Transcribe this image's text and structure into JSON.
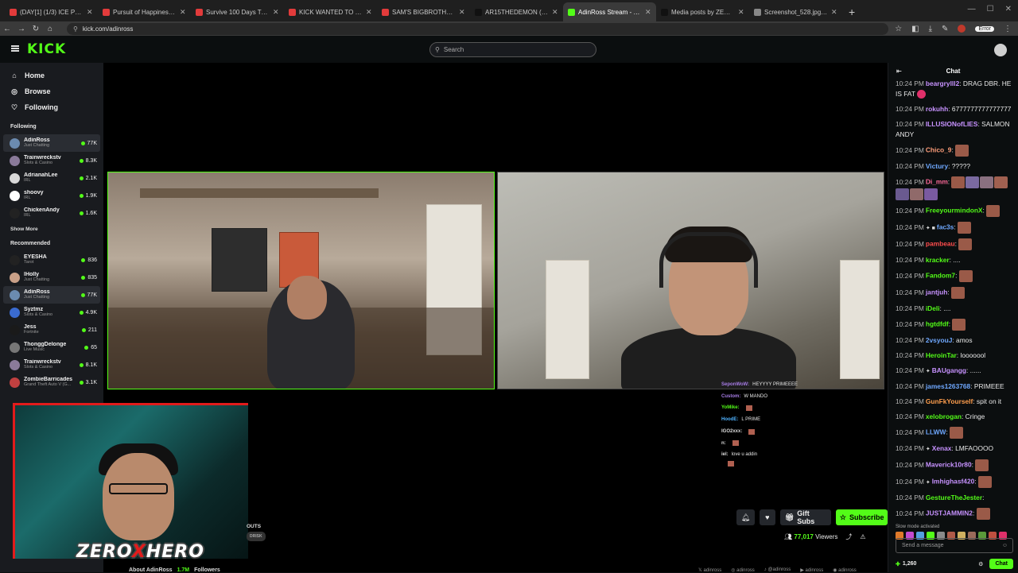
{
  "browser": {
    "tabs": [
      {
        "label": "(DAY[1] (1/3) ICE POSEIDON'S",
        "fav": "#e23b3b",
        "active": false
      },
      {
        "label": "Pursuit of Happiness [Steve Ad",
        "fav": "#e23b3b",
        "active": false
      },
      {
        "label": "Survive 100 Days Trapped In A",
        "fav": "#e23b3b",
        "active": false
      },
      {
        "label": "KICK WANTED TO SIGN ADIN",
        "fav": "#e23b3b",
        "active": false
      },
      {
        "label": "SAM'S BIGBROTHER HOUSE &",
        "fav": "#e23b3b",
        "active": false
      },
      {
        "label": "AR15THEDEMON (@AR15thed",
        "fav": "#111111",
        "active": false
      },
      {
        "label": "AdinRoss Stream - Watch Li",
        "fav": "#53fc18",
        "active": true
      },
      {
        "label": "Media posts by ZEROXHERO (",
        "fav": "#111111",
        "active": false
      },
      {
        "label": "Screenshot_528.jpg (1175×707)",
        "fav": "#888888",
        "active": false
      }
    ],
    "url": "kick.com/adinross",
    "error_label": "Error"
  },
  "header": {
    "logo": "KICK",
    "search_placeholder": "Search"
  },
  "sidebar": {
    "nav": [
      {
        "label": "Home",
        "icon": "home-icon"
      },
      {
        "label": "Browse",
        "icon": "compass-icon"
      },
      {
        "label": "Following",
        "icon": "heart-icon"
      }
    ],
    "following_title": "Following",
    "following": [
      {
        "name": "AdinRoss",
        "category": "Just Chatting",
        "viewers": "77K",
        "color": "#6b8bb0",
        "selected": true
      },
      {
        "name": "Trainwreckstv",
        "category": "Slots & Casino",
        "viewers": "8.3K",
        "color": "#8a7a9a",
        "selected": false
      },
      {
        "name": "AdrianahLee",
        "category": "IRL",
        "viewers": "2.1K",
        "color": "#d8d8d8",
        "selected": false
      },
      {
        "name": "shoovy",
        "category": "IRL",
        "viewers": "1.9K",
        "color": "#ffffff",
        "selected": false
      },
      {
        "name": "ChickenAndy",
        "category": "IRL",
        "viewers": "1.6K",
        "color": "#222222",
        "selected": false
      }
    ],
    "show_more": "Show More",
    "recommended_title": "Recommended",
    "recommended": [
      {
        "name": "EYESHA",
        "category": "Tarot",
        "viewers": "836",
        "color": "#222222",
        "selected": false
      },
      {
        "name": "lHolly",
        "category": "Just Chatting",
        "viewers": "835",
        "color": "#c9a088",
        "selected": false
      },
      {
        "name": "AdinRoss",
        "category": "Just Chatting",
        "viewers": "77K",
        "color": "#6b8bb0",
        "selected": true
      },
      {
        "name": "Syztmz",
        "category": "Slots & Casino",
        "viewers": "4.9K",
        "color": "#3a6bd0",
        "selected": false
      },
      {
        "name": "Jess",
        "category": "Fortnite",
        "viewers": "211",
        "color": "#1a1a1a",
        "selected": false
      },
      {
        "name": "ThonggDelonge",
        "category": "Live Music",
        "viewers": "65",
        "color": "#777777",
        "selected": false
      },
      {
        "name": "Trainwreckstv",
        "category": "Slots & Casino",
        "viewers": "8.1K",
        "color": "#8a7a9a",
        "selected": false
      },
      {
        "name": "ZombieBarricades",
        "category": "Grand Theft Auto V (G...",
        "viewers": "3.1K",
        "color": "#c04040",
        "selected": false
      }
    ]
  },
  "stream": {
    "overlay_chat": [
      {
        "user": "SeponWoW:",
        "text": "HEYYYY PRIMEEEE",
        "color": "#a77ce6"
      },
      {
        "user": "Custom:",
        "text": "W MANDO",
        "color": "#a77ce6"
      },
      {
        "user": "YoMike:",
        "text": "",
        "color": "#53fc18"
      },
      {
        "user": "HoodE:",
        "text": "L PRIME",
        "color": "#4fb3ff"
      },
      {
        "user": "IGO2xxx:",
        "text": "",
        "color": "#dddddd"
      },
      {
        "user": "n:",
        "text": "",
        "color": "#dddddd"
      },
      {
        "user": "iel:",
        "text": "love u addin",
        "color": "#dddddd"
      },
      {
        "user": "",
        "text": "",
        "color": "#e74c6b"
      }
    ],
    "logo_text_left": "ZERO",
    "logo_text_x": "X",
    "logo_text_right": "HERO",
    "info_partial": "OUTS",
    "info_tag": "DRISK",
    "about_label": "About AdinRoss",
    "about_follows": "1.7M",
    "about_follows_label": "Followers",
    "gift_label": "Gift Subs",
    "subscribe_label": "Subscribe",
    "viewers_count": "77,017",
    "viewers_label": "Viewers",
    "socials": [
      "adinross",
      "adinross",
      "@adinross",
      "adinross",
      "adinross"
    ]
  },
  "chat": {
    "title": "Chat",
    "messages": [
      {
        "ts": "10:24 PM",
        "user": "beargrylll2",
        "color": "#c792ff",
        "text": "DRAG DBR. HE IS FAT",
        "emotes": 1,
        "badge": ""
      },
      {
        "ts": "10:24 PM",
        "user": "rokuhh",
        "color": "#c792ff",
        "text": "6777777777777777",
        "emotes": 0,
        "badge": ""
      },
      {
        "ts": "10:24 PM",
        "user": "ILLUSIONofLIES",
        "color": "#c792ff",
        "text": "SALMON ANDY",
        "emotes": 0,
        "badge": ""
      },
      {
        "ts": "10:24 PM",
        "user": "Chico_9",
        "color": "#ff9e7a",
        "text": "",
        "emotes": 1,
        "badge": ""
      },
      {
        "ts": "10:24 PM",
        "user": "Victury",
        "color": "#6fa8ff",
        "text": "?????",
        "emotes": 0,
        "badge": ""
      },
      {
        "ts": "10:24 PM",
        "user": "Di_mm",
        "color": "#ff6b9a",
        "text": "",
        "emotes": 7,
        "badge": ""
      },
      {
        "ts": "10:24 PM",
        "user": "FreeyourmindonX",
        "color": "#53fc18",
        "text": "",
        "emotes": 1,
        "badge": ""
      },
      {
        "ts": "10:24 PM",
        "user": "fac3s",
        "color": "#6fa8ff",
        "text": "",
        "emotes": 1,
        "badge": "✦ ■"
      },
      {
        "ts": "10:24 PM",
        "user": "pambeau",
        "color": "#ff4d4d",
        "text": "",
        "emotes": 1,
        "badge": ""
      },
      {
        "ts": "10:24 PM",
        "user": "kracker",
        "color": "#53fc18",
        "text": "....",
        "emotes": 0,
        "badge": ""
      },
      {
        "ts": "10:24 PM",
        "user": "Fandom7",
        "color": "#53fc18",
        "text": "",
        "emotes": 1,
        "badge": ""
      },
      {
        "ts": "10:24 PM",
        "user": "jantjuh",
        "color": "#c792ff",
        "text": "",
        "emotes": 1,
        "badge": ""
      },
      {
        "ts": "10:24 PM",
        "user": "iDeli",
        "color": "#53fc18",
        "text": "....",
        "emotes": 0,
        "badge": ""
      },
      {
        "ts": "10:24 PM",
        "user": "hgtdfdf",
        "color": "#53fc18",
        "text": "",
        "emotes": 1,
        "badge": ""
      },
      {
        "ts": "10:24 PM",
        "user": "2vsyouJ",
        "color": "#6fa8ff",
        "text": "amos",
        "emotes": 0,
        "badge": ""
      },
      {
        "ts": "10:24 PM",
        "user": "HeroinTar",
        "color": "#53fc18",
        "text": "looooool",
        "emotes": 0,
        "badge": ""
      },
      {
        "ts": "10:24 PM",
        "user": "BAUgangg",
        "color": "#c792ff",
        "text": "......",
        "emotes": 0,
        "badge": "✦"
      },
      {
        "ts": "10:24 PM",
        "user": "james1263768",
        "color": "#6fa8ff",
        "text": "PRIMEEE",
        "emotes": 0,
        "badge": ""
      },
      {
        "ts": "10:24 PM",
        "user": "GunFkYourself",
        "color": "#ff9e4d",
        "text": "spit on it",
        "emotes": 0,
        "badge": ""
      },
      {
        "ts": "10:24 PM",
        "user": "xelobrogan",
        "color": "#53fc18",
        "text": "Cringe",
        "emotes": 0,
        "badge": ""
      },
      {
        "ts": "10:24 PM",
        "user": "LLWW",
        "color": "#6fa8ff",
        "text": "",
        "emotes": 1,
        "badge": ""
      },
      {
        "ts": "10:24 PM",
        "user": "Xenax",
        "color": "#c792ff",
        "text": "LMFAOOOO",
        "emotes": 0,
        "badge": "✦"
      },
      {
        "ts": "10:24 PM",
        "user": "Maverick10r80",
        "color": "#c792ff",
        "text": "",
        "emotes": 1,
        "badge": ""
      },
      {
        "ts": "10:24 PM",
        "user": "Imhighasf420",
        "color": "#c792ff",
        "text": "",
        "emotes": 1,
        "badge": "✦"
      },
      {
        "ts": "10:24 PM",
        "user": "GestureTheJester",
        "color": "#53fc18",
        "text": "",
        "emotes": 0,
        "badge": ""
      },
      {
        "ts": "10:24 PM",
        "user": "JUSTJAMMIN2",
        "color": "#c792ff",
        "text": "",
        "emotes": 1,
        "badge": ""
      }
    ],
    "slow_mode": "Slow mode activated",
    "send_placeholder": "Send a message",
    "points": "1,260",
    "chat_button": "Chat"
  }
}
